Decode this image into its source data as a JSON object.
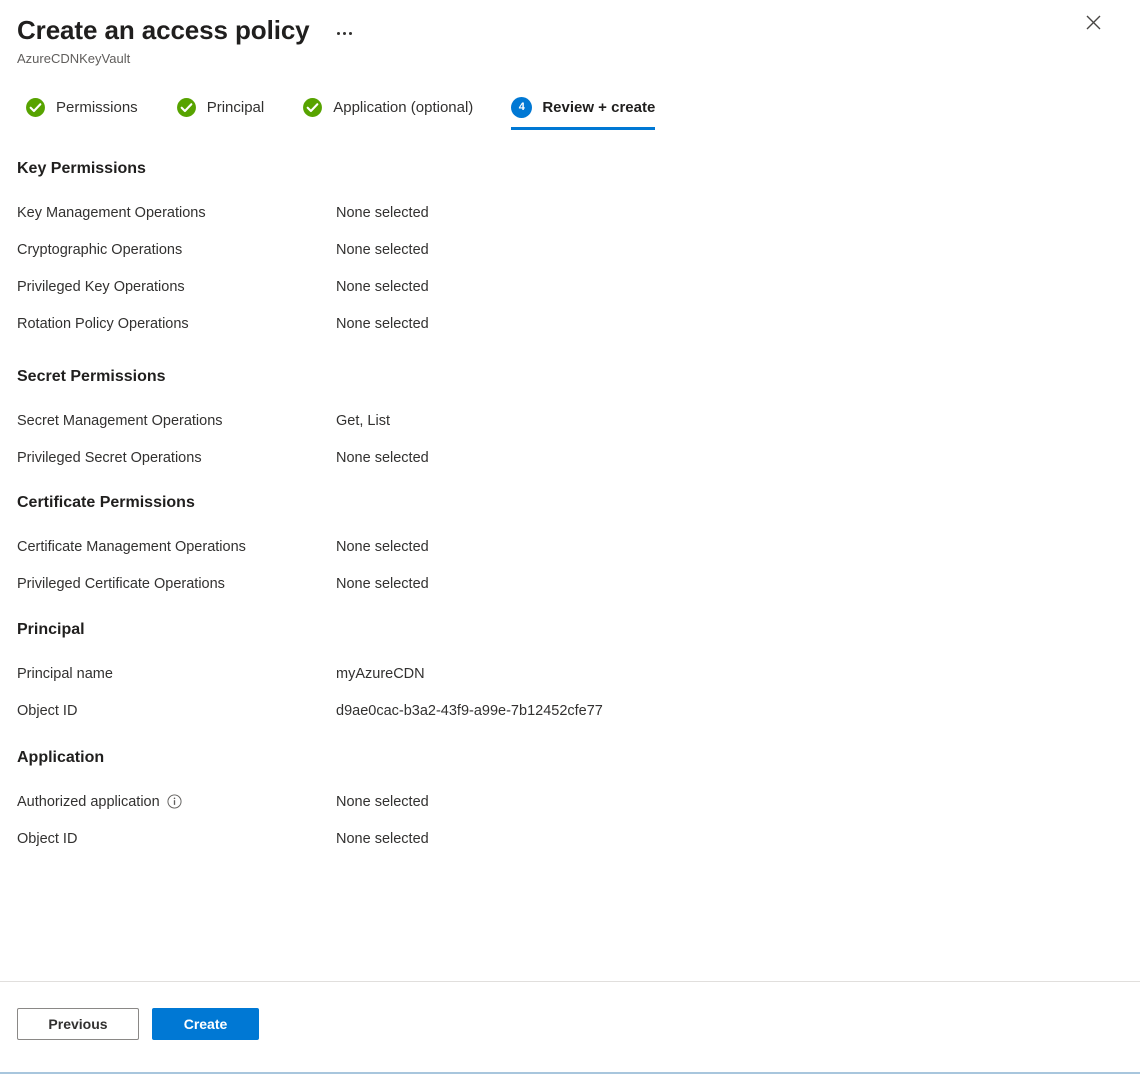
{
  "header": {
    "title": "Create an access policy",
    "subtitle": "AzureCDNKeyVault",
    "more_menu": "more-options",
    "close": "close"
  },
  "tabs": [
    {
      "label": "Permissions",
      "state": "complete",
      "icon": "check-circle-icon"
    },
    {
      "label": "Principal",
      "state": "complete",
      "icon": "check-circle-icon"
    },
    {
      "label": "Application (optional)",
      "state": "complete",
      "icon": "check-circle-icon"
    },
    {
      "label": "Review + create",
      "state": "active",
      "badge": "4"
    }
  ],
  "sections": [
    {
      "heading": "Key Permissions",
      "rows": [
        {
          "label": "Key Management Operations",
          "value": "None selected"
        },
        {
          "label": "Cryptographic Operations",
          "value": "None selected"
        },
        {
          "label": "Privileged Key Operations",
          "value": "None selected"
        },
        {
          "label": "Rotation Policy Operations",
          "value": "None selected"
        }
      ]
    },
    {
      "heading": "Secret Permissions",
      "rows": [
        {
          "label": "Secret Management Operations",
          "value": "Get, List"
        },
        {
          "label": "Privileged Secret Operations",
          "value": "None selected"
        }
      ]
    },
    {
      "heading": "Certificate Permissions",
      "rows": [
        {
          "label": "Certificate Management Operations",
          "value": "None selected"
        },
        {
          "label": "Privileged Certificate Operations",
          "value": "None selected"
        }
      ]
    },
    {
      "heading": "Principal",
      "rows": [
        {
          "label": "Principal name",
          "value": "myAzureCDN"
        },
        {
          "label": "Object ID",
          "value": "d9ae0cac-b3a2-43f9-a99e-7b12452cfe77"
        }
      ]
    },
    {
      "heading": "Application",
      "rows": [
        {
          "label": "Authorized application",
          "value": "None selected",
          "info": true
        },
        {
          "label": "Object ID",
          "value": "None selected"
        }
      ]
    }
  ],
  "footer": {
    "previous_label": "Previous",
    "create_label": "Create"
  },
  "colors": {
    "accent": "#0078d4",
    "success": "#57a300",
    "text": "#323130",
    "muted": "#605e5c"
  }
}
